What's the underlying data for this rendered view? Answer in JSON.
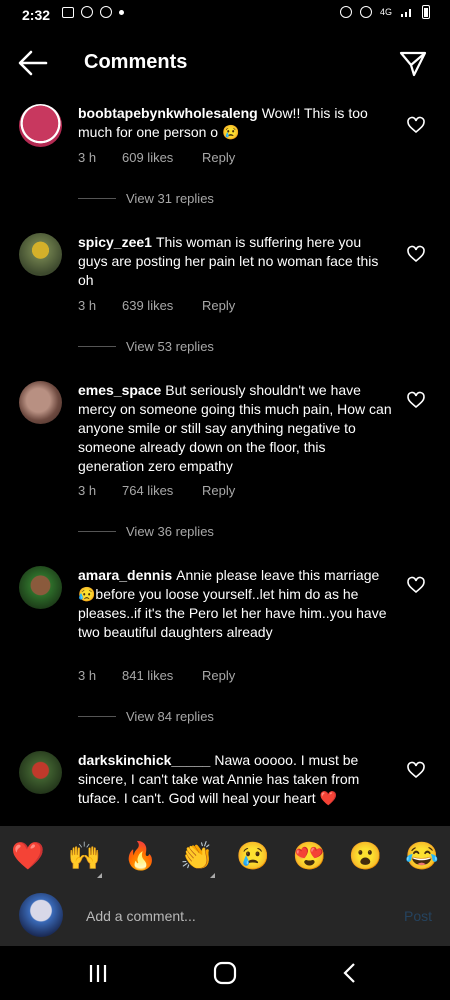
{
  "status": {
    "time": "2:32",
    "network": "4G"
  },
  "header": {
    "title": "Comments"
  },
  "comments": [
    {
      "username": "boobtapebynkwholesaleng",
      "text": "Wow!! This is too much for one person o 😢",
      "time": "3 h",
      "likes": "609 likes",
      "reply": "Reply",
      "view_replies": "View 31 replies"
    },
    {
      "username": "spicy_zee1",
      "text": "This woman is suffering here you guys are posting her pain let no woman face this oh",
      "time": "3 h",
      "likes": "639 likes",
      "reply": "Reply",
      "view_replies": "View 53 replies"
    },
    {
      "username": "emes_space",
      "text": "But seriously shouldn't we have mercy on someone going this much pain, How can anyone smile or still say anything negative to someone already down on the floor, this generation zero empathy",
      "time": "3 h",
      "likes": "764 likes",
      "reply": "Reply",
      "view_replies": "View 36 replies"
    },
    {
      "username": "amara_dennis",
      "text": "Annie please leave this marriage 😥before you loose yourself..let him do as he pleases..if it's the Pero let her have him..you have two beautiful daughters already",
      "time": "3 h",
      "likes": "841 likes",
      "reply": "Reply",
      "view_replies": "View 84 replies"
    },
    {
      "username": "darkskinchick_____",
      "text": "Nawa ooooo. I must be sincere, I can't take wat Annie has taken from tuface. I can't. God will heal your heart ❤️"
    }
  ],
  "emojis": [
    "❤️",
    "🙌",
    "🔥",
    "👏",
    "😢",
    "😍",
    "😮",
    "😂"
  ],
  "composer": {
    "placeholder": "Add a comment...",
    "post_label": "Post"
  },
  "colors": {
    "background": "#000000",
    "secondary_text": "#a8a8a8",
    "post_disabled": "#25435f",
    "bar": "#262626"
  }
}
